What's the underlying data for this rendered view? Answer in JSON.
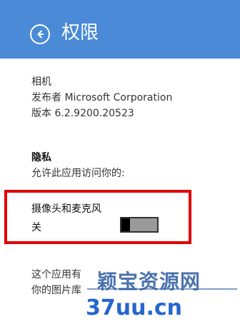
{
  "header": {
    "title": "权限",
    "accent": "#4a8ad6"
  },
  "app": {
    "name": "相机",
    "publisher": "发布者 Microsoft Corporation",
    "version": "版本 6.2.9200.20523"
  },
  "privacy": {
    "title": "隐私",
    "description": "允许此应用访问你的:"
  },
  "camera_mic": {
    "label": "摄像头和麦克风",
    "state_text": "关"
  },
  "bottom": {
    "line1": "这个应用有",
    "line2": "你的图片库"
  },
  "watermarks": {
    "top": "颖宝资源网",
    "bottom": "37uu.cn"
  },
  "icons": {
    "back": "back-arrow-icon"
  }
}
